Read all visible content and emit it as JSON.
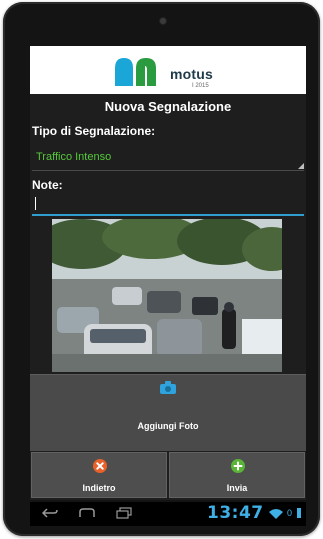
{
  "app": {
    "brand": "motus",
    "brand_sub": "I 2015",
    "brand_colors": {
      "blue": "#1aa7d8",
      "green": "#2a9c3f",
      "dark": "#1f3b49"
    }
  },
  "form": {
    "title": "Nuova Segnalazione",
    "type_label": "Tipo di Segnalazione:",
    "type_value": "Traffico Intenso",
    "note_label": "Note:",
    "note_value": ""
  },
  "photo": {
    "alt": "traffic-photo"
  },
  "actions": {
    "add_photo": "Aggiungi Foto",
    "back": "Indietro",
    "send": "Invia"
  },
  "system": {
    "clock": "13:47",
    "status_num": "0",
    "accent": "#3fb0e6"
  }
}
